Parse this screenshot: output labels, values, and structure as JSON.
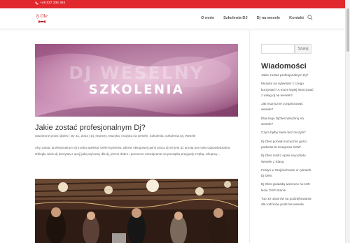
{
  "topbar": {
    "phone": "+48 537 335 384",
    "color": "#e0282e"
  },
  "header": {
    "logo_text": "Dj Oles",
    "nav": [
      {
        "label": "O mnie"
      },
      {
        "label": "Szkolenia DJ"
      },
      {
        "label": "Dj na wesele"
      },
      {
        "label": "Kontakt"
      }
    ]
  },
  "post": {
    "image_line1": "DJ WESELNY",
    "image_line2": "SZKOLENIA",
    "title": "Jakie zostać profesjonalnym Dj?",
    "meta": "utworzone przez djoles  |  sty 31, 2023  |  Dj, Imprezy, Muzyka, muzyka na wesele, Szkolenia, Szkolenia Dj, Wesele",
    "excerpt": "Aby zostać profesjonalnym dj trzeba spełniać wiele kryteriów, wbrew obiegowej opinii praca dj nie jest aż prosta ani mało odpowiedzialna. Obiegło wielu dj korzysta z opcji jaką są kursy dla dj, jest to dobre i pomocne rozwiązanie na początku przygody z Djką. Skupmy..."
  },
  "sidebar": {
    "search_placeholder": "",
    "search_button": "Szukaj",
    "heading": "Wiadomości",
    "items": [
      {
        "text": "Jakie zostać profesjonalnym Dj?"
      },
      {
        "text": "Muzyka na sylwester z czego korzystać? A może lepiej skorzystać z usług dj na wesele?"
      },
      {
        "text": "Jak muzyczne zorganizować wesele?"
      },
      {
        "text": "Dlaczego DjOles Wodzirej na wesele?"
      },
      {
        "text": "Czym byłby świat bez muzyki?"
      },
      {
        "text": "Dj Oles porwał muzyczne gości podczas III Kongresu KGW"
      },
      {
        "text": "Dj Oles mistrz opinii na portalu Wesele z Klasą"
      },
      {
        "text": "Festyn w Wojciechowie w rytmach Dj Oles"
      },
      {
        "text": "Dj Oles gwiazdą wieczoru na 100-lecie OSP Stanin"
      },
      {
        "text": "Top 10 utworów na podziękowania dla rodziców podczas wesela"
      }
    ]
  }
}
